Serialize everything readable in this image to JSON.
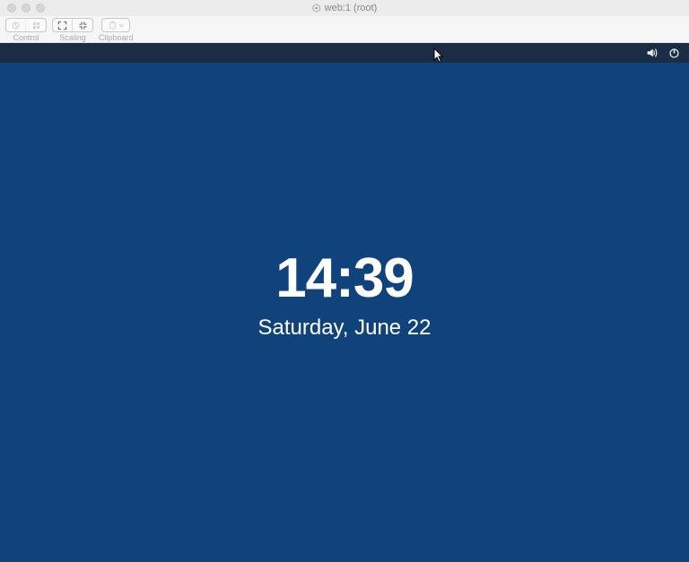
{
  "window": {
    "title": "web:1 (root)"
  },
  "toolbar": {
    "control_label": "Control",
    "scaling_label": "Scaling",
    "clipboard_label": "Clipboard"
  },
  "lockscreen": {
    "time": "14:39",
    "date": "Saturday, June 22"
  },
  "icons": {
    "volume": "volume-icon",
    "power": "power-icon"
  }
}
